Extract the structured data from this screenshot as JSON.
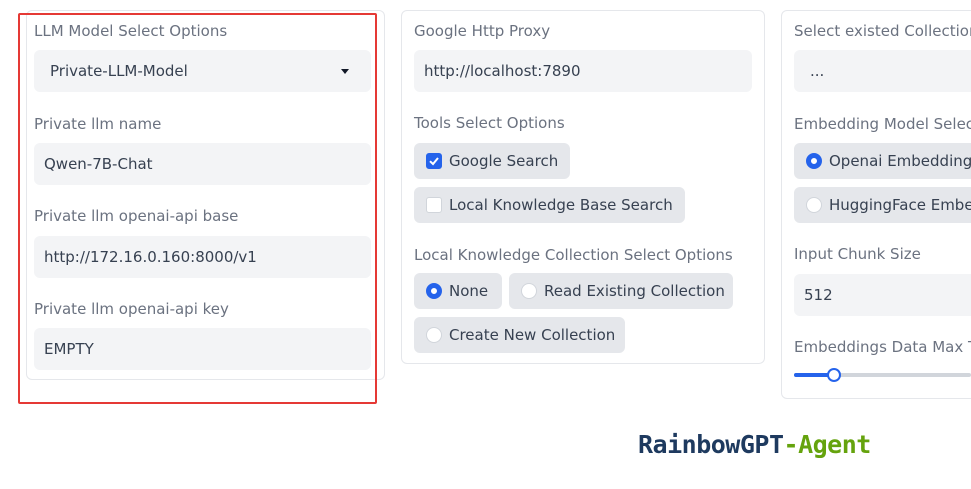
{
  "left_panel": {
    "llm_select_label": "LLM Model Select Options",
    "llm_select_value": "Private-LLM-Model",
    "private_name_label": "Private llm name",
    "private_name_value": "Qwen-7B-Chat",
    "api_base_label": "Private llm openai-api base",
    "api_base_value": "http://172.16.0.160:8000/v1",
    "api_key_label": "Private llm openai-api key",
    "api_key_value": "EMPTY"
  },
  "middle_panel": {
    "proxy_label": "Google Http Proxy",
    "proxy_value": "http://localhost:7890",
    "tools_label": "Tools Select Options",
    "tools": [
      {
        "label": "Google Search",
        "checked": true
      },
      {
        "label": "Local Knowledge Base Search",
        "checked": false
      }
    ],
    "collection_label": "Local Knowledge Collection Select Options",
    "collection_options": [
      {
        "label": "None",
        "selected": true
      },
      {
        "label": "Read Existing Collection",
        "selected": false
      },
      {
        "label": "Create New Collection",
        "selected": false
      }
    ]
  },
  "right_panel": {
    "existed_label": "Select existed Collection",
    "existed_value": "...",
    "embedding_label": "Embedding Model Selec",
    "embedding_options": [
      {
        "label": "Openai Embedding",
        "selected": true
      },
      {
        "label": "HuggingFace Embe",
        "selected": false
      }
    ],
    "chunk_label": "Input Chunk Size",
    "chunk_value": "512",
    "max_label": "Embeddings Data Max T",
    "slider_fraction": 0.2
  },
  "brand": {
    "part1": "RainbowGPT",
    "part2": "-Agent",
    "color1": "#1e3a5f",
    "color2": "#65a30d"
  },
  "colors": {
    "accent": "#2563eb",
    "highlight_frame": "#e53935"
  }
}
